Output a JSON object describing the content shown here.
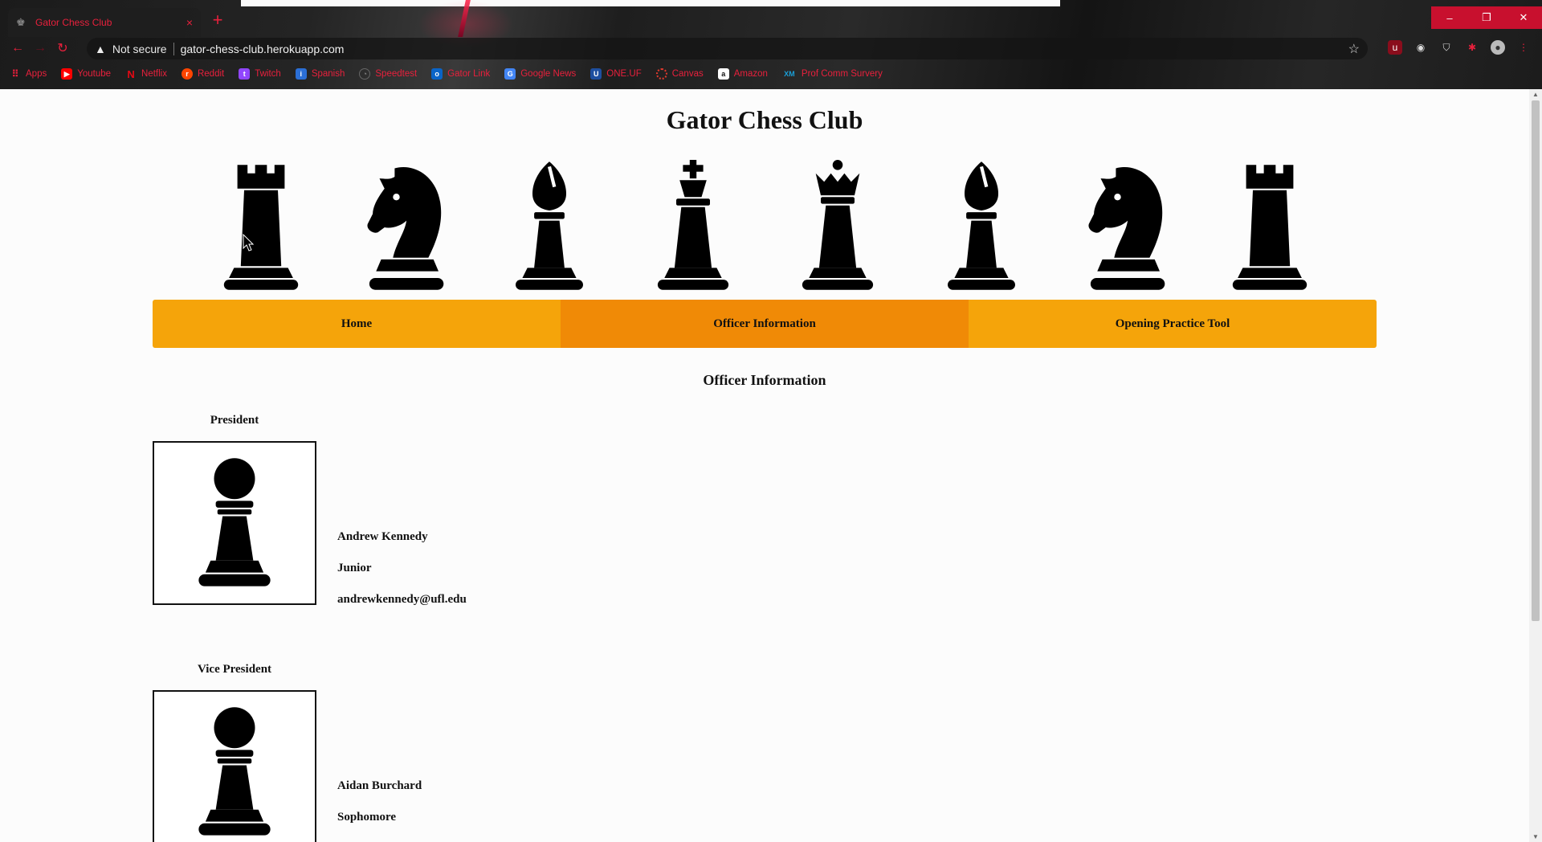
{
  "browser": {
    "tab_title": "Gator Chess Club",
    "tab_close": "×",
    "new_tab": "+",
    "security_label": "Not secure",
    "url": "gator-chess-club.herokuapp.com",
    "window_controls": {
      "minimize": "–",
      "restore": "❐",
      "close": "✕"
    },
    "bookmarks": [
      {
        "label": "Apps",
        "icon": "apps-grid-icon",
        "color": "#e8203c"
      },
      {
        "label": "Youtube",
        "icon": "youtube-icon",
        "color": "#ff0000"
      },
      {
        "label": "Netflix",
        "icon": "netflix-icon",
        "color": "#e50914"
      },
      {
        "label": "Reddit",
        "icon": "reddit-icon",
        "color": "#ff4500"
      },
      {
        "label": "Twitch",
        "icon": "twitch-icon",
        "color": "#9146ff"
      },
      {
        "label": "Spanish",
        "icon": "spanish-icon",
        "color": "#2b6fd6"
      },
      {
        "label": "Speedtest",
        "icon": "speedtest-icon",
        "color": "#444444"
      },
      {
        "label": "Gator Link",
        "icon": "outlook-icon",
        "color": "#0a64c8"
      },
      {
        "label": "Google News",
        "icon": "google-news-icon",
        "color": "#4285f4"
      },
      {
        "label": "ONE.UF",
        "icon": "uf-icon",
        "color": "#1e4fa0"
      },
      {
        "label": "Canvas",
        "icon": "canvas-icon",
        "color": "#e13a2e"
      },
      {
        "label": "Amazon",
        "icon": "amazon-icon",
        "color": "#ffffff"
      },
      {
        "label": "Prof Comm Survery",
        "icon": "xm-icon",
        "color": "#1a9fd8"
      }
    ]
  },
  "site": {
    "title": "Gator Chess Club",
    "pieces": [
      "rook",
      "knight",
      "bishop",
      "king",
      "queen",
      "bishop",
      "knight",
      "rook"
    ],
    "nav": [
      {
        "label": "Home",
        "active": false
      },
      {
        "label": "Officer Information",
        "active": true
      },
      {
        "label": "Opening Practice Tool",
        "active": false
      }
    ],
    "section_title": "Officer Information",
    "officers": [
      {
        "role": "President",
        "name": "Andrew Kennedy",
        "year": "Junior",
        "email": "andrewkennedy@ufl.edu"
      },
      {
        "role": "Vice President",
        "name": "Aidan Burchard",
        "year": "Sophomore",
        "email": ""
      }
    ]
  },
  "colors": {
    "nav_bg": "#f5a40a",
    "nav_active": "#f08a06",
    "accent_red": "#e8203c"
  }
}
